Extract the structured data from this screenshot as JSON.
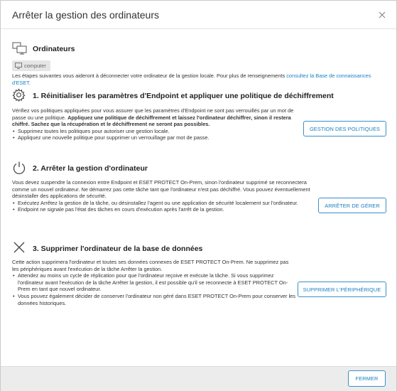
{
  "dialog": {
    "title": "Arrêter la gestion des ordinateurs"
  },
  "computers": {
    "heading": "Ordinateurs",
    "chip_label": "computer",
    "intro_text": "Les étapes suivantes vous aideront à déconnecter votre ordinateur de la gestion locale. Pour plus de renseignements ",
    "intro_link": "consultez la Base de connaissances d'ESET."
  },
  "step1": {
    "heading": "1. Réinitialiser les paramètres d'Endpoint et appliquer une politique de déchiffrement",
    "text_normal": "Vérifiez vos politiques appliquées pour vous assurer que les paramètres d'Endpoint ne sont pas verrouillés par un mot de passe ou une politique. ",
    "text_bold": "Appliquez une politique de déchiffrement et laissez l'ordinateur déchiffrer, sinon il restera chiffré. Sachez que la récupération et le déchiffrement ne seront pas possibles.",
    "bullets": [
      "Supprimez toutes les politiques pour autoriser une gestion locale.",
      "Appliquez une nouvelle politique pour supprimer un verrouillage par mot de passe."
    ],
    "button": "GESTION DES POLITIQUES"
  },
  "step2": {
    "heading": "2. Arrêter la gestion d'ordinateur",
    "text": "Vous devez suspendre la connexion entre Endpoint et ESET PROTECT On-Prem, sinon l'ordinateur supprimé se reconnectera comme un nouvel ordinateur. Ne démarrez pas cette tâche tant que l'ordinateur n'est pas déchiffré. Vous pouvez éventuellement désinstaller des applications de sécurité.",
    "bullets": [
      "Exécutez Arrêtez la gestion de la tâche, ou désinstallez l'agent ou une application de sécurité localement sur l'ordinateur.",
      "Endpoint ne signale pas l'état des tâches en cours d'exécution après l'arrêt de la gestion."
    ],
    "button": "ARRÊTER DE GÉRER"
  },
  "step3": {
    "heading": "3. Supprimer l'ordinateur de la base de données",
    "text": "Cette action supprimera l'ordinateur et toutes ses données connexes de ESET PROTECT On-Prem. Ne supprimez pas les périphériques avant l'exécution de la tâche Arrêter la gestion.",
    "bullets": [
      "Attendez au moins un cycle de réplication pour que l'ordinateur reçoive et exécute la tâche. Si vous supprimez l'ordinateur avant l'exécution de la tâche Arrêter la gestion, il est possible qu'il se reconnecte à ESET PROTECT On-Prem en tant que nouvel ordinateur.",
      "Vous pouvez également décider de conserver l'ordinateur non géré dans ESET PROTECT On-Prem pour conserver les données historiques."
    ],
    "button": "SUPPRIMER L'PÉRIPHÉRIQUE"
  },
  "footer": {
    "close_button": "FERMER"
  }
}
